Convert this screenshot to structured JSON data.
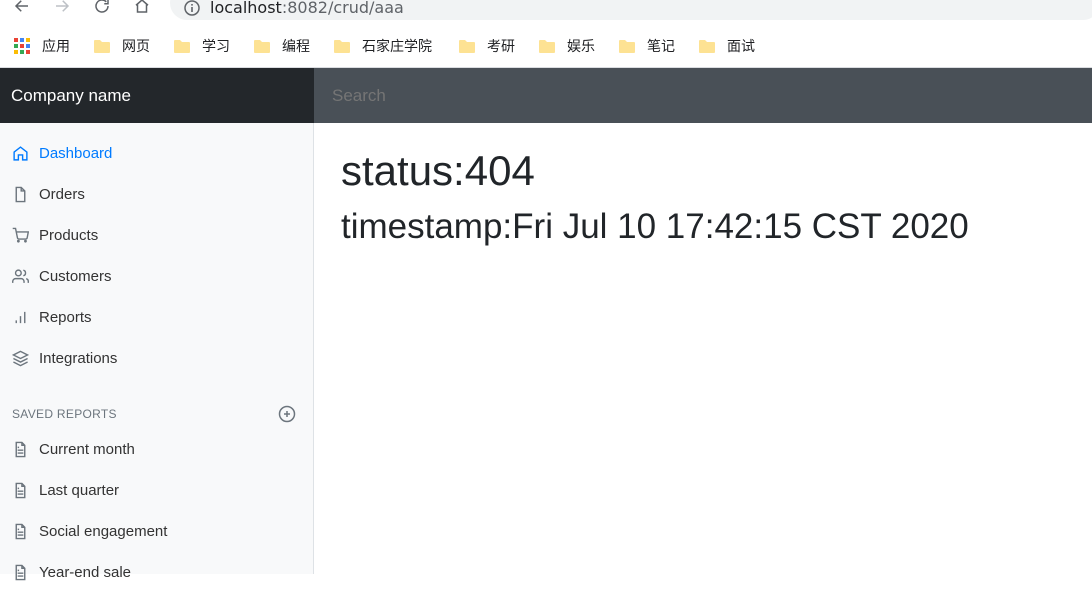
{
  "browser": {
    "url_host": "localhost",
    "url_rest": ":8082/crud/aaa",
    "bookmarks": [
      {
        "label": "应用",
        "icon": "apps-grid-icon"
      },
      {
        "label": "网页",
        "icon": "folder-icon"
      },
      {
        "label": "学习",
        "icon": "folder-icon"
      },
      {
        "label": "编程",
        "icon": "folder-icon"
      },
      {
        "label": "石家庄学院",
        "icon": "folder-icon"
      },
      {
        "label": "考研",
        "icon": "folder-icon"
      },
      {
        "label": "娱乐",
        "icon": "folder-icon"
      },
      {
        "label": "笔记",
        "icon": "folder-icon"
      },
      {
        "label": "面试",
        "icon": "folder-icon"
      }
    ]
  },
  "header": {
    "brand": "Company name",
    "search_placeholder": "Search"
  },
  "sidebar": {
    "items": [
      {
        "label": "Dashboard",
        "icon": "home-icon",
        "active": true
      },
      {
        "label": "Orders",
        "icon": "file-icon"
      },
      {
        "label": "Products",
        "icon": "shopping-cart-icon"
      },
      {
        "label": "Customers",
        "icon": "users-icon"
      },
      {
        "label": "Reports",
        "icon": "bar-chart-icon"
      },
      {
        "label": "Integrations",
        "icon": "layers-icon"
      }
    ],
    "saved_heading": "SAVED REPORTS",
    "saved_reports": [
      {
        "label": "Current month",
        "icon": "file-text-icon"
      },
      {
        "label": "Last quarter",
        "icon": "file-text-icon"
      },
      {
        "label": "Social engagement",
        "icon": "file-text-icon"
      },
      {
        "label": "Year-end sale",
        "icon": "file-text-icon"
      }
    ]
  },
  "main": {
    "status": "status:404",
    "timestamp": "timestamp:Fri Jul 10 17:42:15 CST 2020"
  },
  "colors": {
    "brand_bg": "#23272b",
    "navbar_bg": "#343a40",
    "search_bg": "#495057",
    "active_link": "#007bff",
    "sidebar_bg": "#f8f9fa"
  }
}
